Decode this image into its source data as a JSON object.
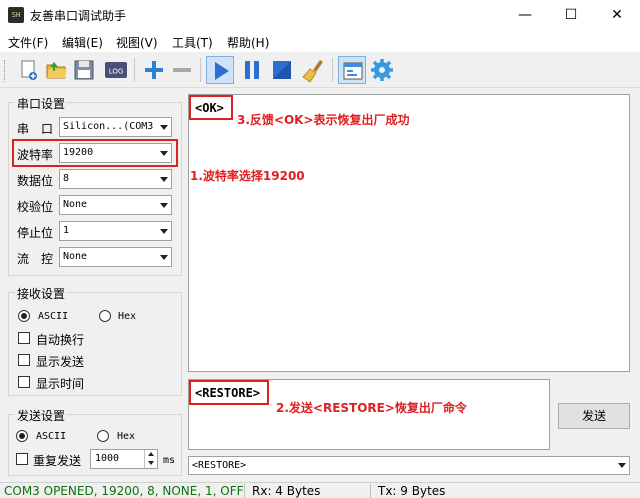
{
  "window": {
    "icon_text": "SH",
    "title": "友善串口调试助手",
    "minimize_glyph": "—",
    "maximize_glyph": "☐",
    "close_glyph": "✕"
  },
  "menu": [
    "文件(F)",
    "编辑(E)",
    "视图(V)",
    "工具(T)",
    "帮助(H)"
  ],
  "toolbar": {
    "icons": [
      "new-file-icon",
      "open-folder-icon",
      "save-icon",
      "log-icon",
      "plus-icon",
      "minus-icon",
      "play-icon",
      "pause-icon",
      "stop-icon",
      "broom-icon",
      "layout-icon",
      "gear-icon"
    ],
    "log_label": "LOG"
  },
  "serial_settings": {
    "title": "串口设置",
    "rows": [
      {
        "label": "串　口",
        "value": "Silicon...(COM3"
      },
      {
        "label": "波特率",
        "value": "19200"
      },
      {
        "label": "数据位",
        "value": "8"
      },
      {
        "label": "校验位",
        "value": "None"
      },
      {
        "label": "停止位",
        "value": "1"
      },
      {
        "label": "流　控",
        "value": "None"
      }
    ]
  },
  "receive_settings": {
    "title": "接收设置",
    "ascii": "ASCII",
    "hex": "Hex",
    "selected": "ASCII",
    "options": [
      "自动换行",
      "显示发送",
      "显示时间"
    ]
  },
  "send_settings": {
    "title": "发送设置",
    "ascii": "ASCII",
    "hex": "Hex",
    "selected": "ASCII",
    "repeat_label": "重复发送",
    "interval": "1000",
    "unit": "ms"
  },
  "receive_area": {
    "text": "<OK>"
  },
  "send_area": {
    "text": "<RESTORE>",
    "send_button": "发送",
    "history_value": "<RESTORE>"
  },
  "annotations": {
    "baud": "1.波特率选择19200",
    "restore": "2.发送<RESTORE>恢复出厂命令",
    "ok": "3.反馈<OK>表示恢复出厂成功",
    "color": "#e02020"
  },
  "status": {
    "port": "COM3 OPENED, 19200, 8, NONE, 1, OFF",
    "rx": "Rx: 4 Bytes",
    "tx": "Tx: 9 Bytes",
    "port_color": "#107010"
  }
}
